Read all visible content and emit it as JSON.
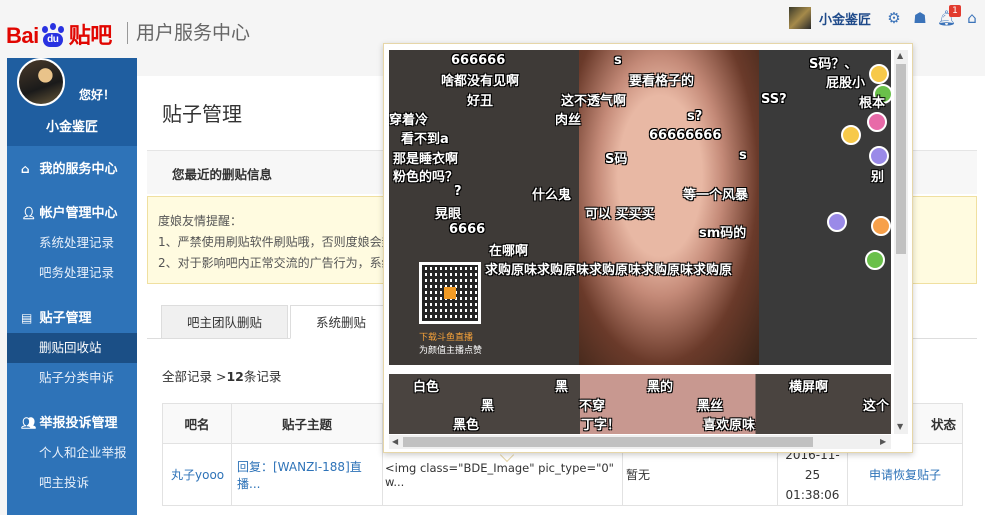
{
  "header": {
    "logo_bai": "Bai",
    "logo_du": "du",
    "logo_tieba": "贴吧",
    "site_title": "用户服务中心",
    "username": "小金鉴匠",
    "notification_count": "1"
  },
  "sidebar": {
    "greeting": "您好！",
    "username": "小金鉴匠",
    "groups": [
      {
        "label": "我的服务中心",
        "icon": "home-icon"
      },
      {
        "label": "帐户管理中心",
        "icon": "user-icon",
        "items": [
          "系统处理记录",
          "吧务处理记录"
        ]
      },
      {
        "label": "贴子管理",
        "icon": "document-icon",
        "items": [
          "删贴回收站",
          "贴子分类申诉"
        ]
      },
      {
        "label": "举报投诉管理",
        "icon": "users-icon",
        "items": [
          "个人和企业举报",
          "吧主投诉"
        ]
      }
    ]
  },
  "main": {
    "title": "贴子管理",
    "recent_title": "您最近的删贴信息",
    "notice": {
      "heading": "度娘友情提醒：",
      "line1": "1、严禁使用刷贴软件刷贴哦，否则度娘会封",
      "line2": "2、对于影响吧内正常交流的广告行为，系统"
    },
    "tabs": [
      "吧主团队删贴",
      "系统删贴"
    ],
    "records_prefix": "全部记录 >",
    "records_count": "12",
    "records_suffix": "条记录",
    "table": {
      "headers": [
        "吧名",
        "贴子主题",
        "",
        "",
        "",
        "状态"
      ],
      "row": {
        "bar": "丸子yooo",
        "topic": "回复：[WANZI-188]直播...",
        "content": "<img class=\"BDE_Image\" pic_type=\"0\" w...",
        "reason": "暂无",
        "date": "2016-11-25",
        "time": "01:38:06",
        "action": "申请恢复贴子"
      }
    }
  },
  "popup": {
    "danmaku": [
      "666666",
      "啥都没有见啊",
      "好丑",
      "这不透气啊",
      "要看格子的",
      "s",
      "S码？、",
      "屁股小",
      "SS?",
      "根本",
      "肉丝",
      "s?",
      "穿着冷",
      "看不到a",
      "66666666",
      "那是睡衣啊",
      "S码",
      "粉色的吗？",
      "s",
      "什么鬼",
      "等一个风暴",
      "别",
      "?",
      "晃眼",
      "可以 买买买",
      "6666",
      "sm码的",
      "在哪啊",
      "求购原味求购原味求购原味求购原味求购原",
      "白色",
      "黑",
      "黑的",
      "横屏啊",
      "黑",
      "黑丝",
      "这个",
      "黑色",
      "不穿",
      "丁字！",
      "喜欢原味"
    ],
    "qr_caption1": "下载斗鱼直播",
    "qr_caption2": "为颜值主播点赞"
  },
  "colors": {
    "brand_red": "#e10601",
    "sidebar_blue": "#2e73b8",
    "link_blue": "#2e73b8",
    "notice_bg": "#fffbe0"
  }
}
